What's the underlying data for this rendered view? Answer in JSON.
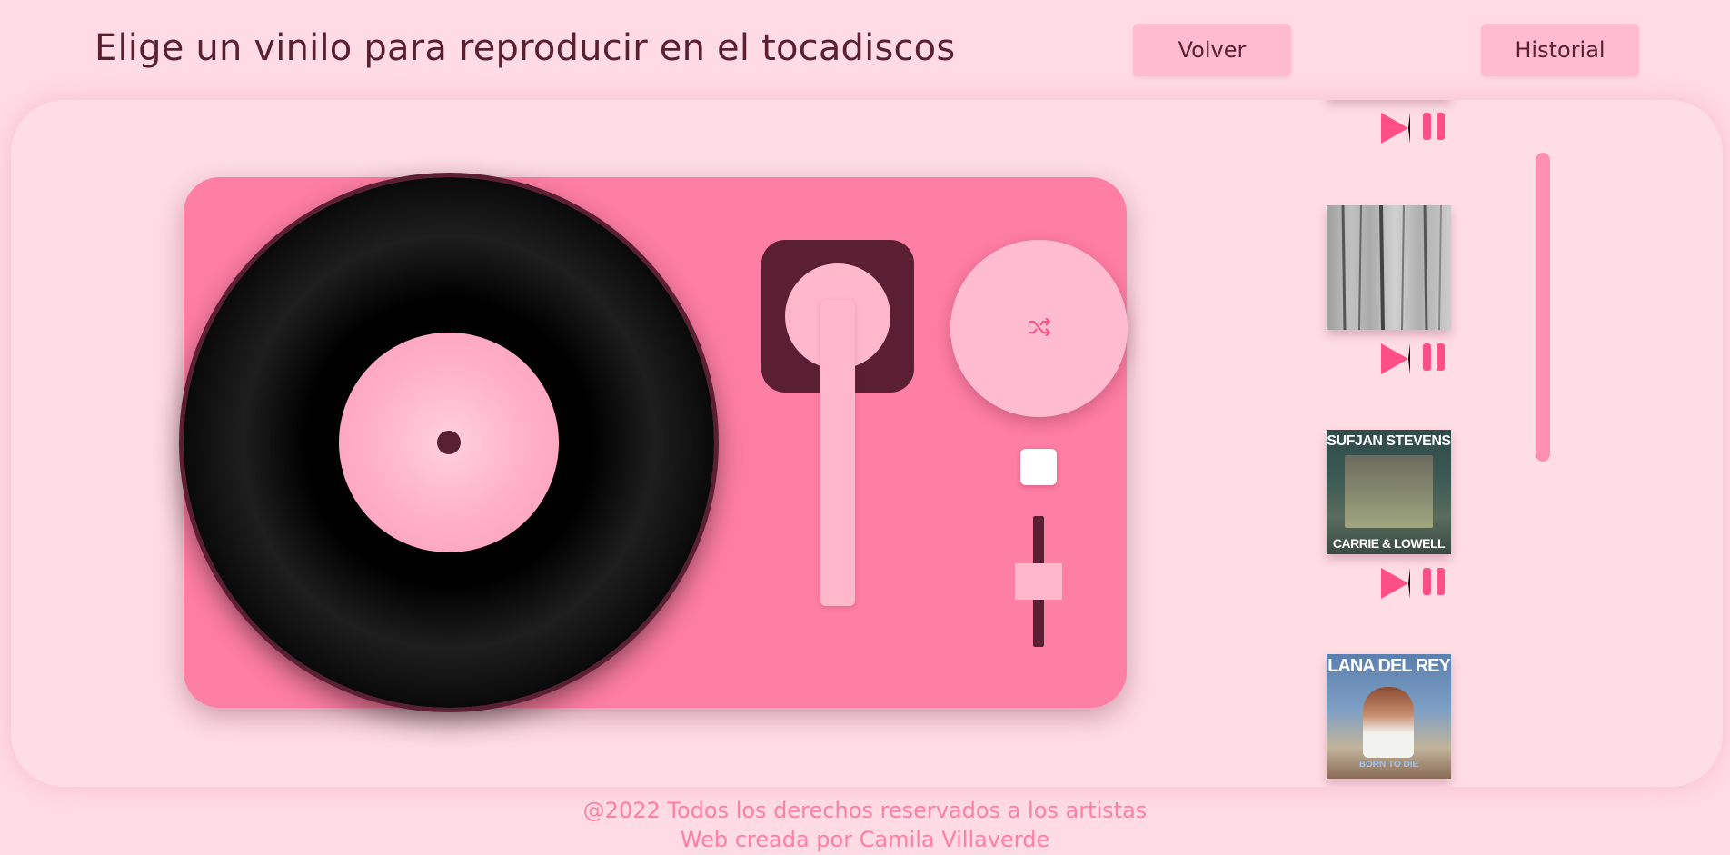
{
  "header": {
    "title": "Elige un vinilo para reproducir en el tocadiscos",
    "back_label": "Volver",
    "history_label": "Historial"
  },
  "turntable": {
    "shuffle_icon": "shuffle-icon",
    "stop_icon": "stop-square-icon",
    "volume_level": 0.5
  },
  "albums": [
    {
      "cover_icon": "album-cover-partial",
      "vinyl_color": "#3b2418"
    },
    {
      "cover_icon": "album-cover-folklore-forest",
      "vinyl_color": "#3b2418"
    },
    {
      "artist": "SUFJAN STEVENS",
      "title": "CARRIE & LOWELL",
      "vinyl_color": "#111111"
    },
    {
      "artist": "LANA DEL REY",
      "title": "BORN TO DIE",
      "vinyl_color": "#111111"
    }
  ],
  "footer": {
    "line1": "@2022 Todos los derechos reservados a los artistas",
    "line2": "Web creada por Camila Villaverde"
  },
  "colors": {
    "background": "#ffdce5",
    "deck": "#ff7ea3",
    "accent": "#ff4f86",
    "dark": "#5a1f33",
    "button": "#ffbcd0"
  }
}
